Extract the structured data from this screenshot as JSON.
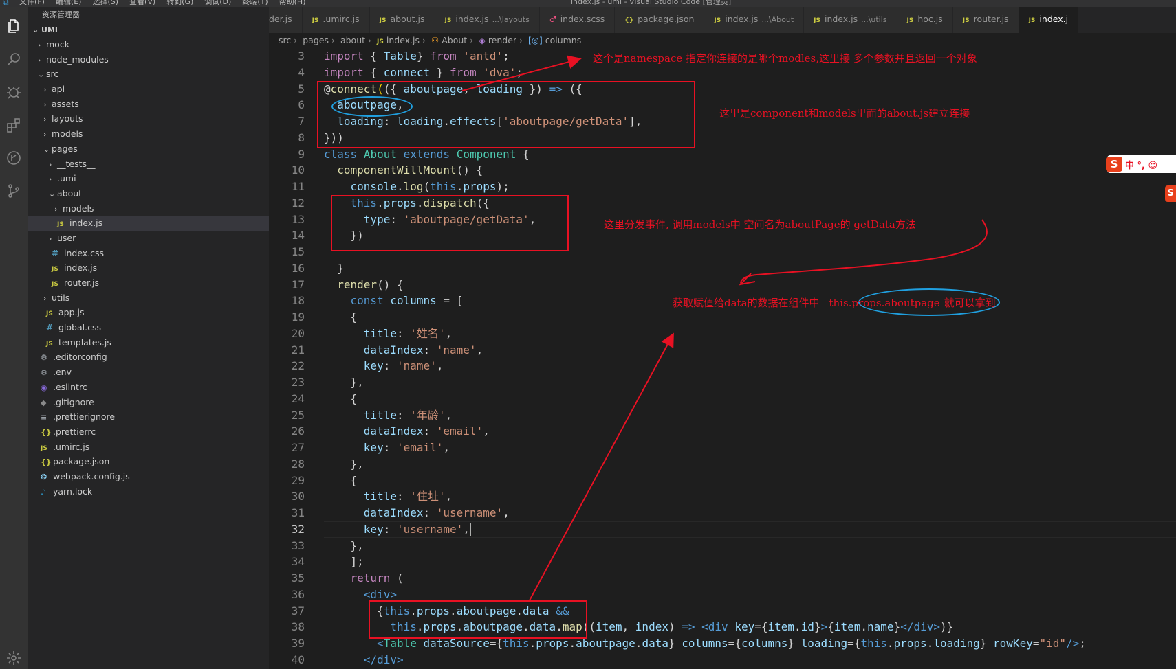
{
  "titlebar": {
    "menu": [
      "文件(F)",
      "编辑(E)",
      "选择(S)",
      "查看(V)",
      "转到(G)",
      "调试(D)",
      "终端(T)",
      "帮助(H)"
    ],
    "title": "index.js - umi - Visual Studio Code [管理员]"
  },
  "sidebar": {
    "title": "资源管理器",
    "root": "UMI",
    "items": [
      {
        "label": "mock",
        "chev": "›",
        "icon": "",
        "icon_type": "",
        "indent": 1
      },
      {
        "label": "node_modules",
        "chev": "›",
        "icon": "",
        "icon_type": "",
        "indent": 1
      },
      {
        "label": "src",
        "chev": "⌄",
        "icon": "",
        "icon_type": "",
        "indent": 1
      },
      {
        "label": "api",
        "chev": "›",
        "icon": "",
        "icon_type": "",
        "indent": 2
      },
      {
        "label": "assets",
        "chev": "›",
        "icon": "",
        "icon_type": "",
        "indent": 2
      },
      {
        "label": "layouts",
        "chev": "›",
        "icon": "",
        "icon_type": "",
        "indent": 2
      },
      {
        "label": "models",
        "chev": "›",
        "icon": "",
        "icon_type": "",
        "indent": 2
      },
      {
        "label": "pages",
        "chev": "⌄",
        "icon": "",
        "icon_type": "",
        "indent": 2
      },
      {
        "label": "__tests__",
        "chev": "›",
        "icon": "",
        "icon_type": "",
        "indent": 3
      },
      {
        "label": ".umi",
        "chev": "›",
        "icon": "",
        "icon_type": "",
        "indent": 3
      },
      {
        "label": "about",
        "chev": "⌄",
        "icon": "",
        "icon_type": "",
        "indent": 3
      },
      {
        "label": "models",
        "chev": "›",
        "icon": "",
        "icon_type": "",
        "indent": 4
      },
      {
        "label": "index.js",
        "chev": "",
        "icon": "JS",
        "icon_type": "js",
        "indent": 4,
        "selected": true
      },
      {
        "label": "user",
        "chev": "›",
        "icon": "",
        "icon_type": "",
        "indent": 3
      },
      {
        "label": "index.css",
        "chev": "",
        "icon": "#",
        "icon_type": "css",
        "indent": 3
      },
      {
        "label": "index.js",
        "chev": "",
        "icon": "JS",
        "icon_type": "js",
        "indent": 3
      },
      {
        "label": "router.js",
        "chev": "",
        "icon": "JS",
        "icon_type": "js",
        "indent": 3
      },
      {
        "label": "utils",
        "chev": "›",
        "icon": "",
        "icon_type": "",
        "indent": 2
      },
      {
        "label": "app.js",
        "chev": "",
        "icon": "JS",
        "icon_type": "js",
        "indent": 2
      },
      {
        "label": "global.css",
        "chev": "",
        "icon": "#",
        "icon_type": "css",
        "indent": 2
      },
      {
        "label": "templates.js",
        "chev": "",
        "icon": "JS",
        "icon_type": "js",
        "indent": 2
      },
      {
        "label": ".editorconfig",
        "chev": "",
        "icon": "⚙",
        "icon_type": "cfg",
        "indent": 1
      },
      {
        "label": ".env",
        "chev": "",
        "icon": "⚙",
        "icon_type": "cfg",
        "indent": 1
      },
      {
        "label": ".eslintrc",
        "chev": "",
        "icon": "◉",
        "icon_type": "eslint",
        "indent": 1
      },
      {
        "label": ".gitignore",
        "chev": "",
        "icon": "◆",
        "icon_type": "git",
        "indent": 1
      },
      {
        "label": ".prettierignore",
        "chev": "",
        "icon": "≡",
        "icon_type": "cfg",
        "indent": 1
      },
      {
        "label": ".prettierrc",
        "chev": "",
        "icon": "{}",
        "icon_type": "json",
        "indent": 1
      },
      {
        "label": ".umirc.js",
        "chev": "",
        "icon": "JS",
        "icon_type": "js",
        "indent": 1
      },
      {
        "label": "package.json",
        "chev": "",
        "icon": "{}",
        "icon_type": "json",
        "indent": 1
      },
      {
        "label": "webpack.config.js",
        "chev": "",
        "icon": "❂",
        "icon_type": "wp",
        "indent": 1
      },
      {
        "label": "yarn.lock",
        "chev": "",
        "icon": "♪",
        "icon_type": "yarn",
        "indent": 1
      }
    ]
  },
  "tabs": [
    {
      "label": "der.js",
      "icon": "",
      "hint": ""
    },
    {
      "label": ".umirc.js",
      "icon": "JS",
      "hint": ""
    },
    {
      "label": "about.js",
      "icon": "JS",
      "hint": ""
    },
    {
      "label": "index.js",
      "icon": "JS",
      "hint": "...\\layouts"
    },
    {
      "label": "index.scss",
      "icon": "♂",
      "hint": ""
    },
    {
      "label": "package.json",
      "icon": "{}",
      "hint": ""
    },
    {
      "label": "index.js",
      "icon": "JS",
      "hint": "...\\About"
    },
    {
      "label": "index.js",
      "icon": "JS",
      "hint": "...\\utils"
    },
    {
      "label": "hoc.js",
      "icon": "JS",
      "hint": ""
    },
    {
      "label": "router.js",
      "icon": "JS",
      "hint": ""
    },
    {
      "label": "index.j",
      "icon": "JS",
      "hint": "",
      "active": true
    }
  ],
  "breadcrumb": {
    "src": "src",
    "pages": "pages",
    "about": "about",
    "file": "index.js",
    "class": "About",
    "method": "render",
    "variable": "columns"
  },
  "annotations": {
    "namespace_note": "这个是namespace 指定你连接的是哪个modles,这里接 多个参数并且返回一个对象",
    "connect_note": "这里是component和models里面的about.js建立连接",
    "dispatch_note": "这里分发事件, 调用models中 空间名为aboutPage的 getData方法",
    "data_note_prefix": "获取赋值给data的数据在组件中",
    "data_note_highlight": "this.props.aboutpage",
    "data_note_suffix": "就可以拿到"
  },
  "ime": {
    "logo": "S",
    "text": "中 °, ☺"
  },
  "colors": {
    "annotation_red": "#e81123",
    "annotation_blue": "#20a0e0",
    "editor_bg": "#1e1e1e",
    "sidebar_bg": "#252526"
  }
}
